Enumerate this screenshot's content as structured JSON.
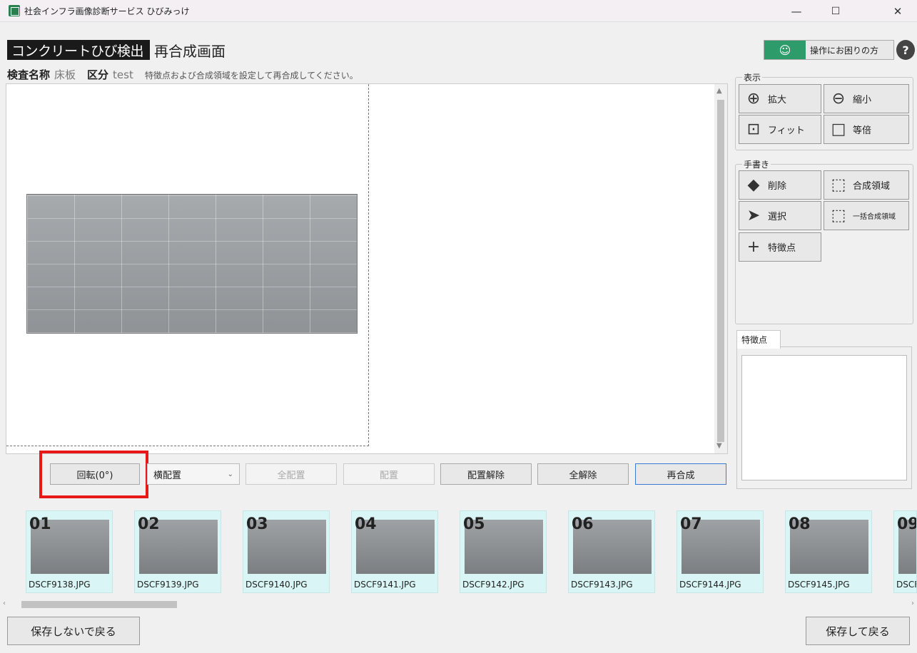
{
  "window": {
    "title": "社会インフラ画像診断サービス ひびみっけ",
    "min": "—",
    "max": "☐",
    "close": "✕"
  },
  "header": {
    "mode": "コンクリートひび検出",
    "screen": "再合成画面",
    "help": "操作にお困りの方",
    "help_q": "?"
  },
  "info": {
    "inspection_label": "検査名称",
    "inspection_value": "床板",
    "category_label": "区分",
    "category_value": "test",
    "note": "特徴点および合成領域を設定して再合成してください。"
  },
  "controls": {
    "rotate": "回転(0°)",
    "layout_select": "横配置",
    "place_all": "全配置",
    "place": "配置",
    "unplace": "配置解除",
    "clear_all": "全解除",
    "recompose": "再合成"
  },
  "view_group": {
    "title": "表示",
    "zoom_in": "拡大",
    "zoom_out": "縮小",
    "fit": "フィット",
    "actual": "等倍"
  },
  "hand_group": {
    "title": "手書き",
    "erase": "削除",
    "region": "合成領域",
    "select": "選択",
    "batch_region": "一括合成領域",
    "feature": "特徴点"
  },
  "feature_panel": {
    "tab": "特徴点"
  },
  "thumbnails": [
    {
      "num": "01",
      "file": "DSCF9138.JPG"
    },
    {
      "num": "02",
      "file": "DSCF9139.JPG"
    },
    {
      "num": "03",
      "file": "DSCF9140.JPG"
    },
    {
      "num": "04",
      "file": "DSCF9141.JPG"
    },
    {
      "num": "05",
      "file": "DSCF9142.JPG"
    },
    {
      "num": "06",
      "file": "DSCF9143.JPG"
    },
    {
      "num": "07",
      "file": "DSCF9144.JPG"
    },
    {
      "num": "08",
      "file": "DSCF9145.JPG"
    },
    {
      "num": "09",
      "file": "DSCF"
    }
  ],
  "footer": {
    "back_no_save": "保存しないで戻る",
    "save_back": "保存して戻る"
  }
}
